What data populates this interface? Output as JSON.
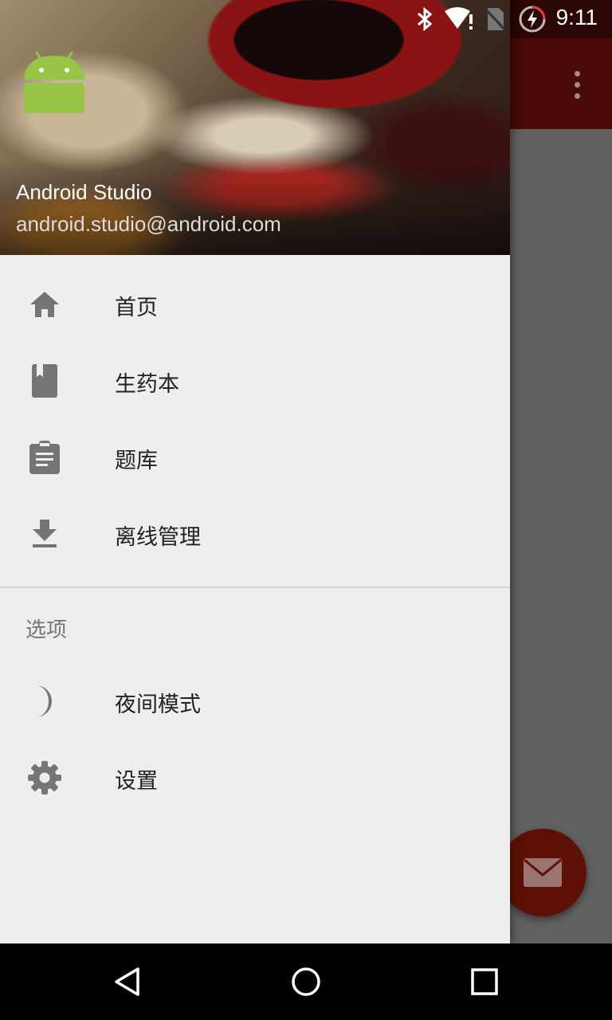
{
  "status_bar": {
    "time": "9:11",
    "icons": [
      "bluetooth-icon",
      "wifi-alert-icon",
      "no-sim-icon",
      "battery-charging-icon"
    ]
  },
  "app": {
    "overflow_icon": "more-vert-icon",
    "fab_icon": "mail-icon"
  },
  "drawer": {
    "header": {
      "avatar_icon": "android-icon",
      "name": "Android Studio",
      "email": "android.studio@android.com"
    },
    "items": [
      {
        "label": "首页",
        "icon": "home-icon"
      },
      {
        "label": "生药本",
        "icon": "book-icon"
      },
      {
        "label": "题库",
        "icon": "clipboard-icon"
      },
      {
        "label": "离线管理",
        "icon": "download-icon"
      }
    ],
    "section_title": "选项",
    "options": [
      {
        "label": "夜间模式",
        "icon": "moon-icon"
      },
      {
        "label": "设置",
        "icon": "settings-icon"
      }
    ]
  },
  "nav_bar": {
    "buttons": [
      "back-icon",
      "home-circle-icon",
      "recents-icon"
    ]
  },
  "colors": {
    "toolbar": "#4a0a05",
    "drawer_bg": "#eeeeee",
    "icon_gray": "#757575",
    "fab": "#5e1006"
  }
}
